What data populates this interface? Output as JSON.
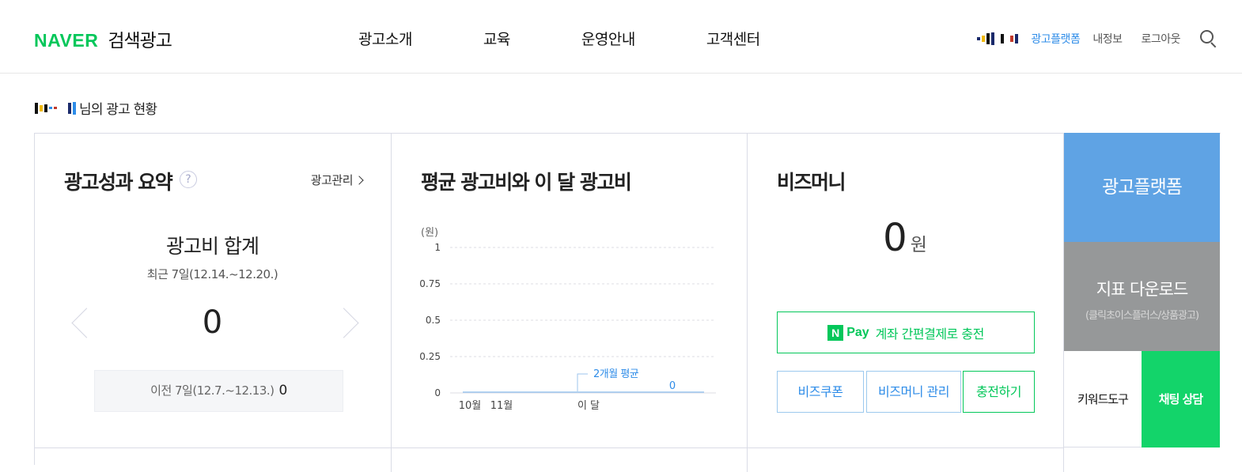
{
  "header": {
    "logo_naver": "NAVER",
    "logo_sub": "검색광고",
    "nav": [
      "광고소개",
      "교육",
      "운영안내",
      "고객센터"
    ],
    "util": {
      "platform": "광고플랫폼",
      "my_info": "내정보",
      "logout": "로그아웃"
    }
  },
  "page_title": "님의 광고 현황",
  "summary": {
    "title": "광고성과 요약",
    "help": "?",
    "manage_link": "광고관리",
    "total_label": "광고비 합계",
    "period": "최근 7일(12.14.~12.20.)",
    "value": "0",
    "prev_label": "이전 7일(12.7.~12.13.)",
    "prev_value": "0"
  },
  "chart_panel": {
    "title": "평균 광고비와 이 달 광고비"
  },
  "chart_data": {
    "type": "line",
    "ylabel": "(원)",
    "ylim": [
      0,
      1
    ],
    "yticks": [
      "1",
      "0.75",
      "0.5",
      "0.25",
      "0"
    ],
    "categories": [
      "10월",
      "11월",
      "이 달"
    ],
    "annotation": "2개월 평균",
    "series": [
      {
        "values": [
          0,
          0,
          0
        ]
      }
    ],
    "current_month_value": "0",
    "grid": true
  },
  "bizmoney": {
    "title": "비즈머니",
    "value": "0",
    "unit": "원",
    "npay_logo": "N",
    "npay_pay": "Pay",
    "npay_text": "계좌 간편결제로 충전",
    "coupon": "비즈쿠폰",
    "manage": "비즈머니 관리",
    "charge": "충전하기"
  },
  "side": {
    "platform": "광고플랫폼",
    "download": "지표 다운로드",
    "download_sub": "(클릭초이스플러스/상품광고)",
    "keyword_tool": "키워드도구",
    "chat": "채팅 상담"
  },
  "colors": {
    "naver_green": "#03c75a",
    "accent_blue": "#2e8ce8",
    "platform_blue": "#5fa3e4",
    "download_gray": "#969899",
    "chat_green": "#13d46a"
  }
}
